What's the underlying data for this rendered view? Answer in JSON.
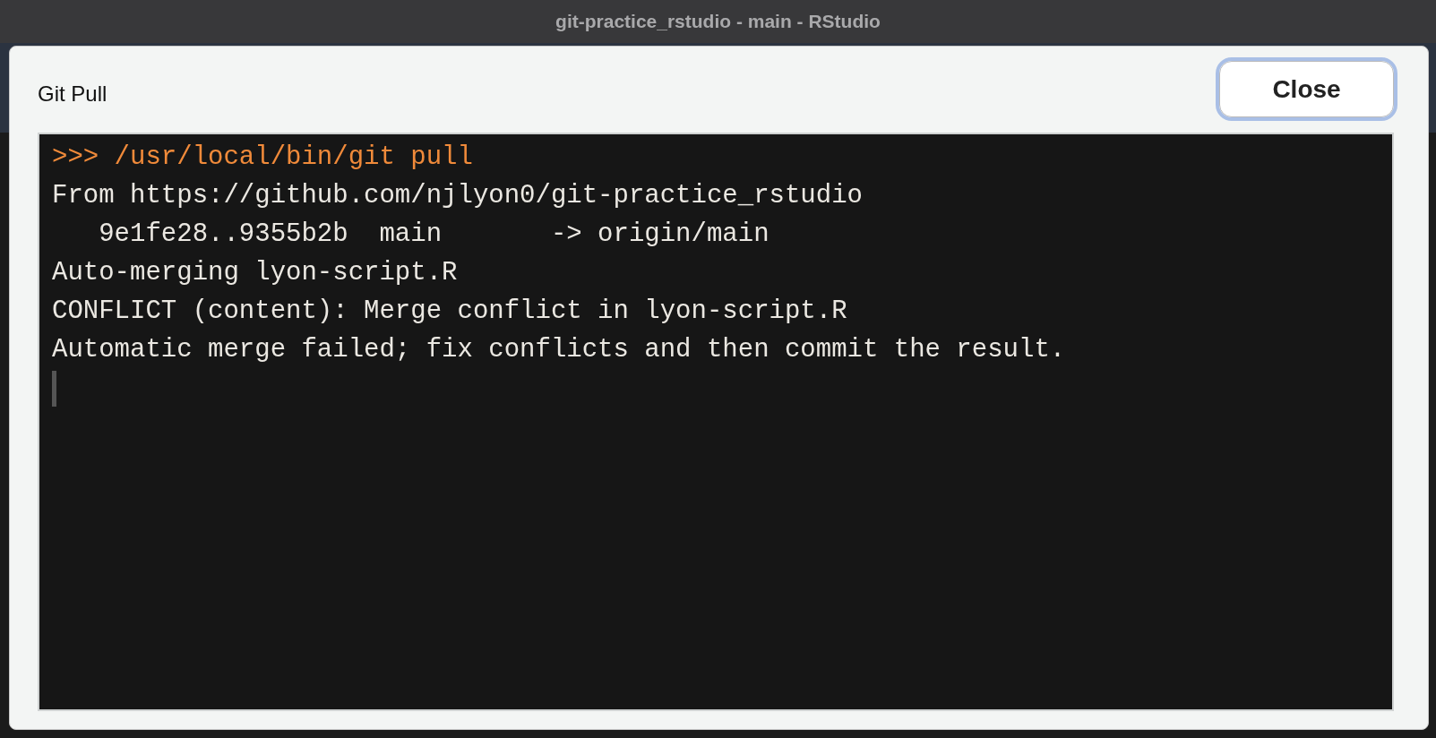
{
  "window": {
    "title": "git-practice_rstudio - main - RStudio"
  },
  "dialog": {
    "title": "Git Pull",
    "close_button": "Close",
    "close_focused": true
  },
  "console": {
    "lines": [
      {
        "kind": "command",
        "text": ">>> /usr/local/bin/git pull"
      },
      {
        "kind": "output",
        "text": "From https://github.com/njlyon0/git-practice_rstudio"
      },
      {
        "kind": "output",
        "text": "   9e1fe28..9355b2b  main       -> origin/main"
      },
      {
        "kind": "output",
        "text": "Auto-merging lyon-script.R"
      },
      {
        "kind": "output",
        "text": "CONFLICT (content): Merge conflict in lyon-script.R"
      },
      {
        "kind": "output",
        "text": "Automatic merge failed; fix conflicts and then commit the result."
      }
    ],
    "cursor": true
  }
}
